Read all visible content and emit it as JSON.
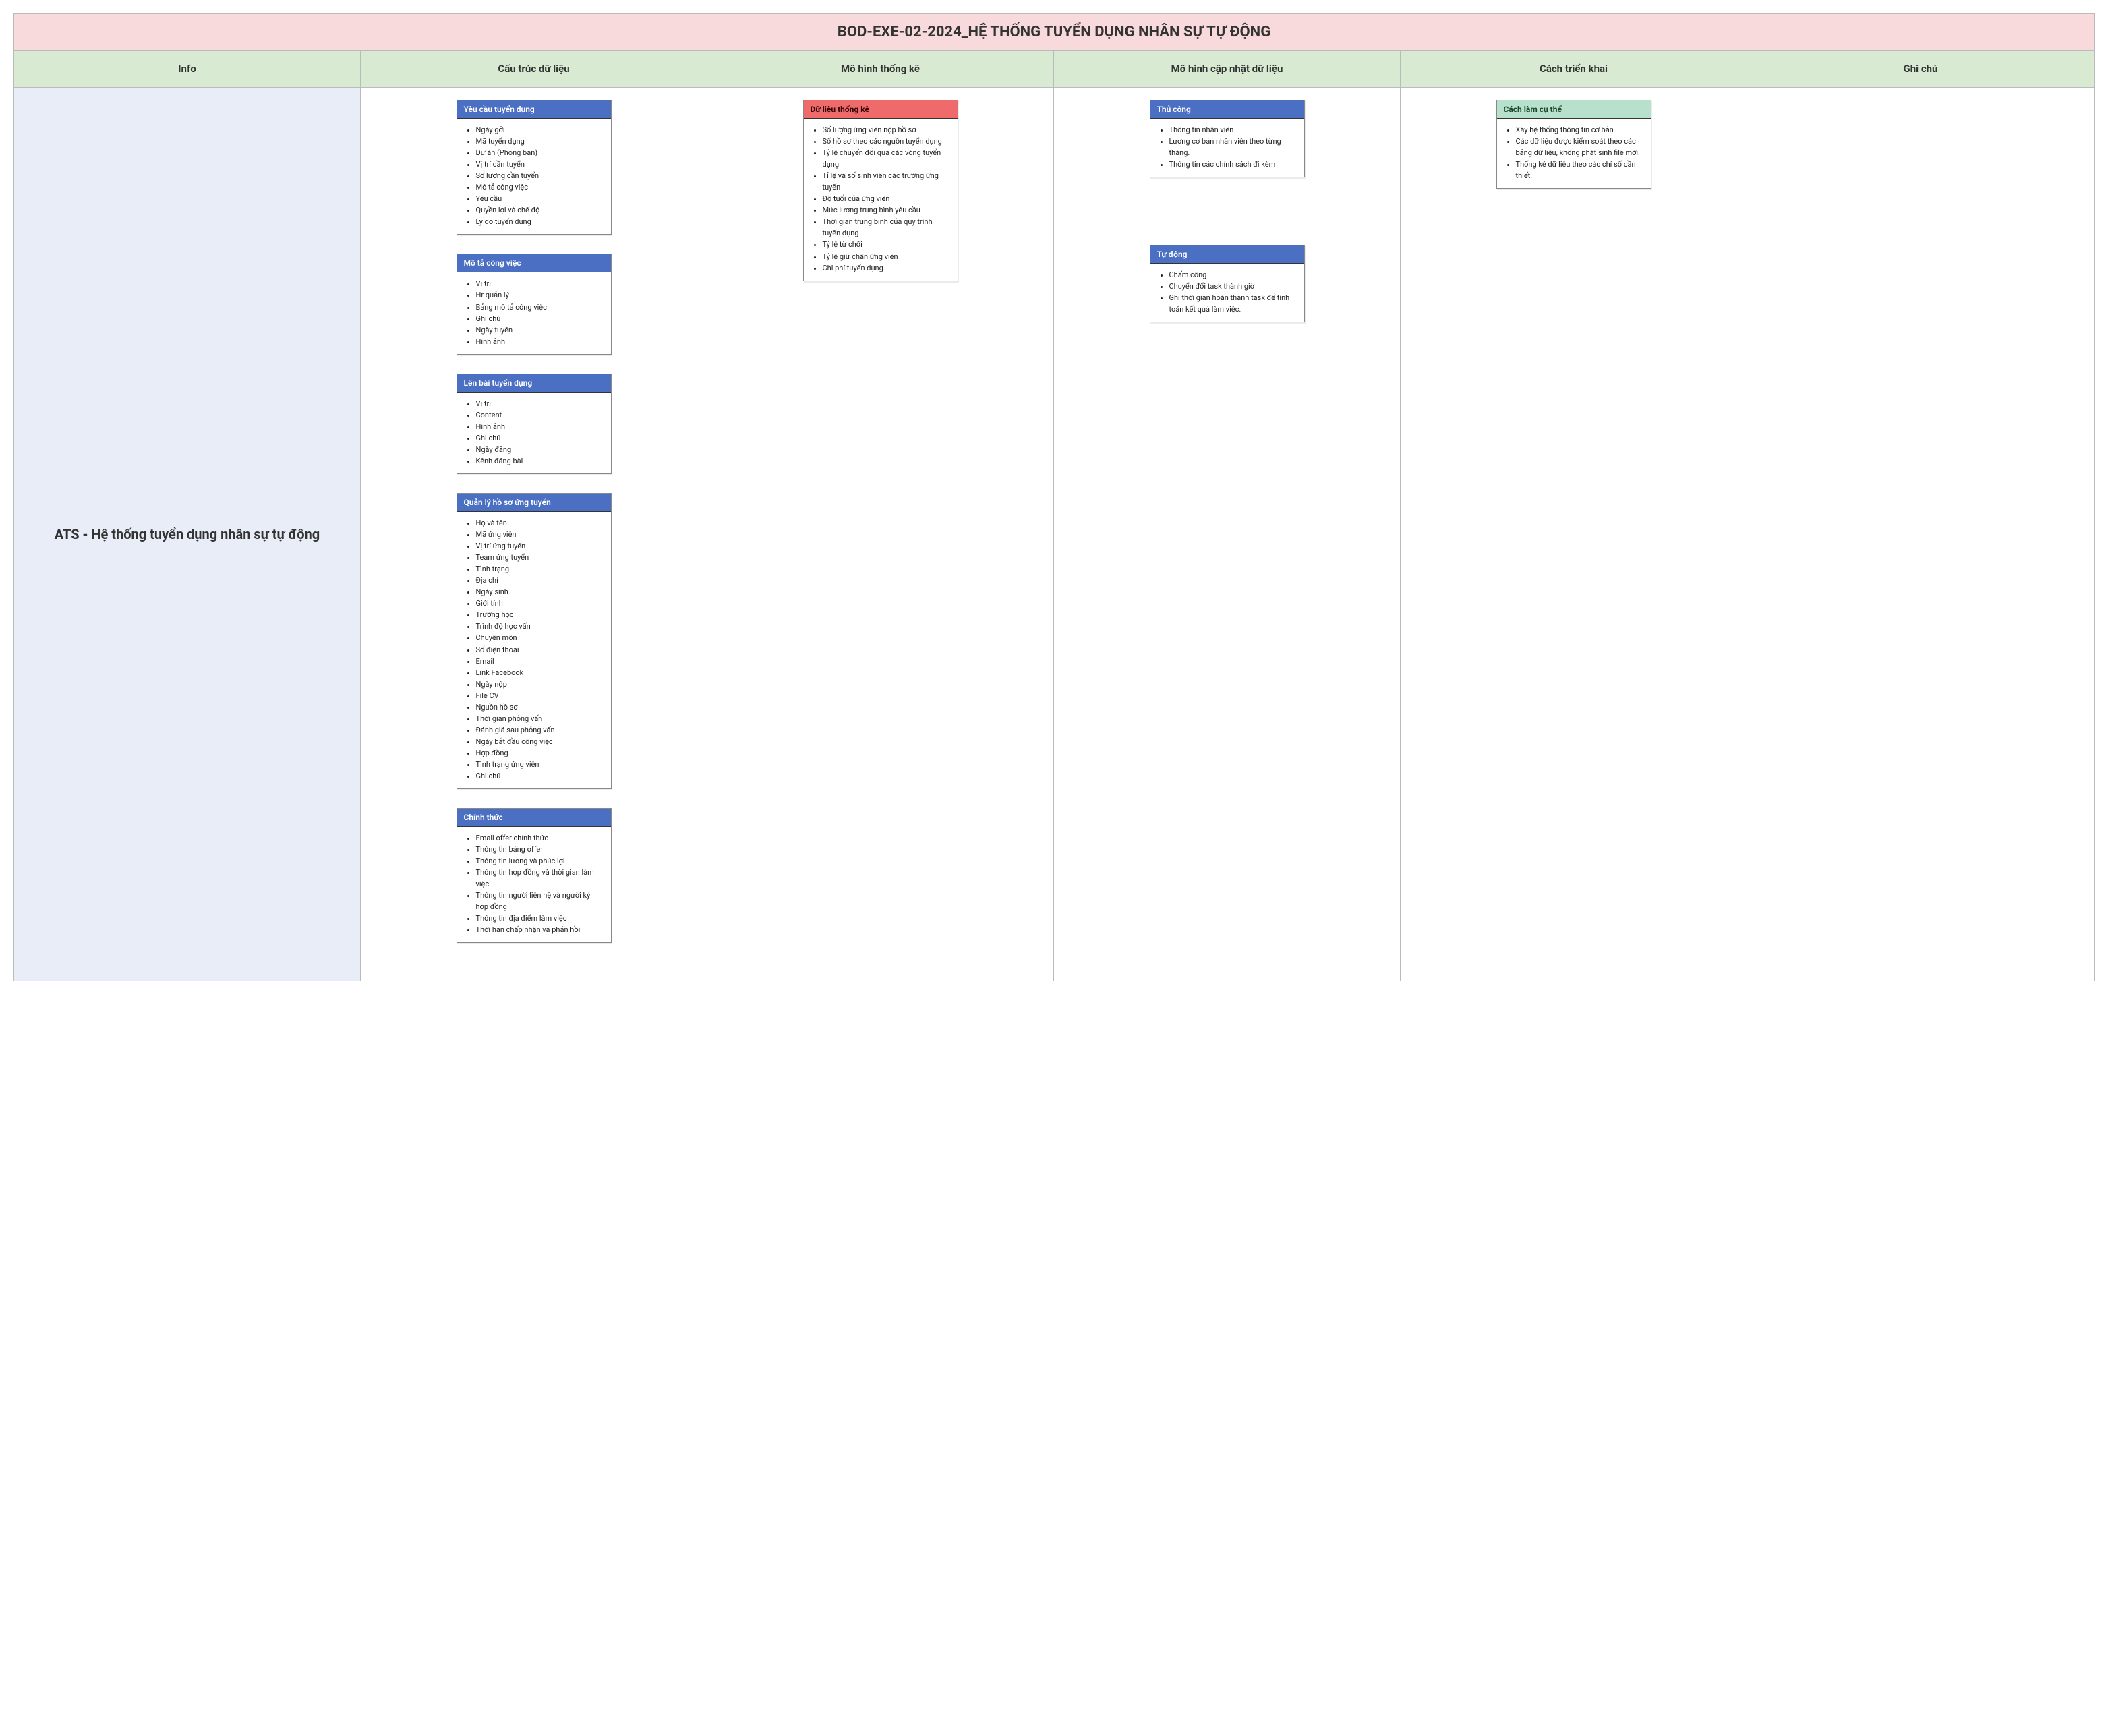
{
  "title": "BOD-EXE-02-2024_HỆ THỐNG TUYỂN DỤNG NHÂN SỰ TỰ ĐỘNG",
  "headers": [
    "Info",
    "Cấu trúc dữ liệu",
    "Mô hình thống kê",
    "Mô hình cập nhật dữ liệu",
    "Cách triển khai",
    "Ghi chú"
  ],
  "info_label": "ATS - Hệ thống tuyển dụng nhân sự tự động",
  "columns": {
    "col1": [
      {
        "title": "Yêu cầu tuyển dụng",
        "style": "blue",
        "items": [
          "Ngày gởi",
          "Mã tuyển dụng",
          "Dự án (Phòng ban)",
          "Vị trí cần tuyển",
          "Số lượng cần tuyển",
          "Mô tả công việc",
          "Yêu cầu",
          "Quyền lợi và chế độ",
          "Lý do tuyển dụng"
        ]
      },
      {
        "title": "Mô tả công việc",
        "style": "blue",
        "items": [
          "Vị trí",
          "Hr quản lý",
          "Bảng mô tả công việc",
          "Ghi chú",
          "Ngày tuyển",
          "Hình ảnh"
        ]
      },
      {
        "title": "Lên bài tuyển dụng",
        "style": "blue",
        "items": [
          "Vị trí",
          "Content",
          "Hình ảnh",
          "Ghi chú",
          "Ngày đăng",
          "Kênh đăng bài"
        ]
      },
      {
        "title": "Quản lý hồ sơ ứng tuyển",
        "style": "blue",
        "items": [
          "Họ và tên",
          "Mã ứng viên",
          "Vị trí ứng tuyển",
          "Team ứng tuyển",
          "Tình trạng",
          "Địa chỉ",
          "Ngày sinh",
          "Giới tính",
          "Trường học",
          "Trình độ học vấn",
          "Chuyên môn",
          "Số điện thoại",
          "Email",
          "Link Facebook",
          "Ngày nộp",
          "File CV",
          "Nguồn hồ sơ",
          "Thời gian phỏng vấn",
          "Đánh giá sau phỏng vấn",
          "Ngày bắt đầu công việc",
          "Hợp đồng",
          "Tình trạng ứng viên",
          "Ghi chú"
        ]
      },
      {
        "title": "Chính thức",
        "style": "blue",
        "items": [
          "Email offer chính thức",
          "Thông tin bảng offer",
          "Thông tin lương và phúc lợi",
          "Thông tin hợp đồng và thời gian làm việc",
          "Thông tin người liên hệ và người ký hợp đồng",
          "Thông tin địa điểm làm việc",
          "Thời hạn chấp nhận và phản hồi"
        ]
      }
    ],
    "col2": [
      {
        "title": "Dữ liệu thống kê",
        "style": "red",
        "items": [
          "Số lượng ứng viên nộp hồ sơ",
          "Số hồ sơ theo các nguồn tuyển dụng",
          "Tỷ lệ chuyển đổi qua các vòng tuyển dụng",
          "Tỉ lệ và số sinh viên các trường ứng tuyển",
          "Độ tuổi của ứng viên",
          "Mức lương trung bình yêu cầu",
          "Thời gian trung bình của quy trình tuyển dụng",
          "Tỷ lệ từ chối",
          "Tỷ lệ giữ chân ứng viên",
          "Chi phí tuyển dụng"
        ]
      }
    ],
    "col3": [
      {
        "title": "Thủ công",
        "style": "blue",
        "items": [
          "Thông tin nhân viên",
          "Lương cơ bản nhân viên theo từng tháng.",
          "Thông tin các chính sách đi kèm"
        ]
      },
      {
        "title": "Tự động",
        "style": "blue",
        "items": [
          "Chấm công",
          "Chuyển đổi task thành giờ",
          "Ghi thời gian hoàn thành task để tính toán  kết quả làm việc."
        ]
      }
    ],
    "col4": [
      {
        "title": "Cách làm cụ thể",
        "style": "green",
        "items": [
          "Xây hệ thống thông tin cơ bản",
          "Các dữ liệu được kiểm soát theo các bảng dữ liệu, không phát sinh file mới.",
          "Thống kê dữ liệu theo các chỉ số cần thiết."
        ]
      }
    ]
  }
}
